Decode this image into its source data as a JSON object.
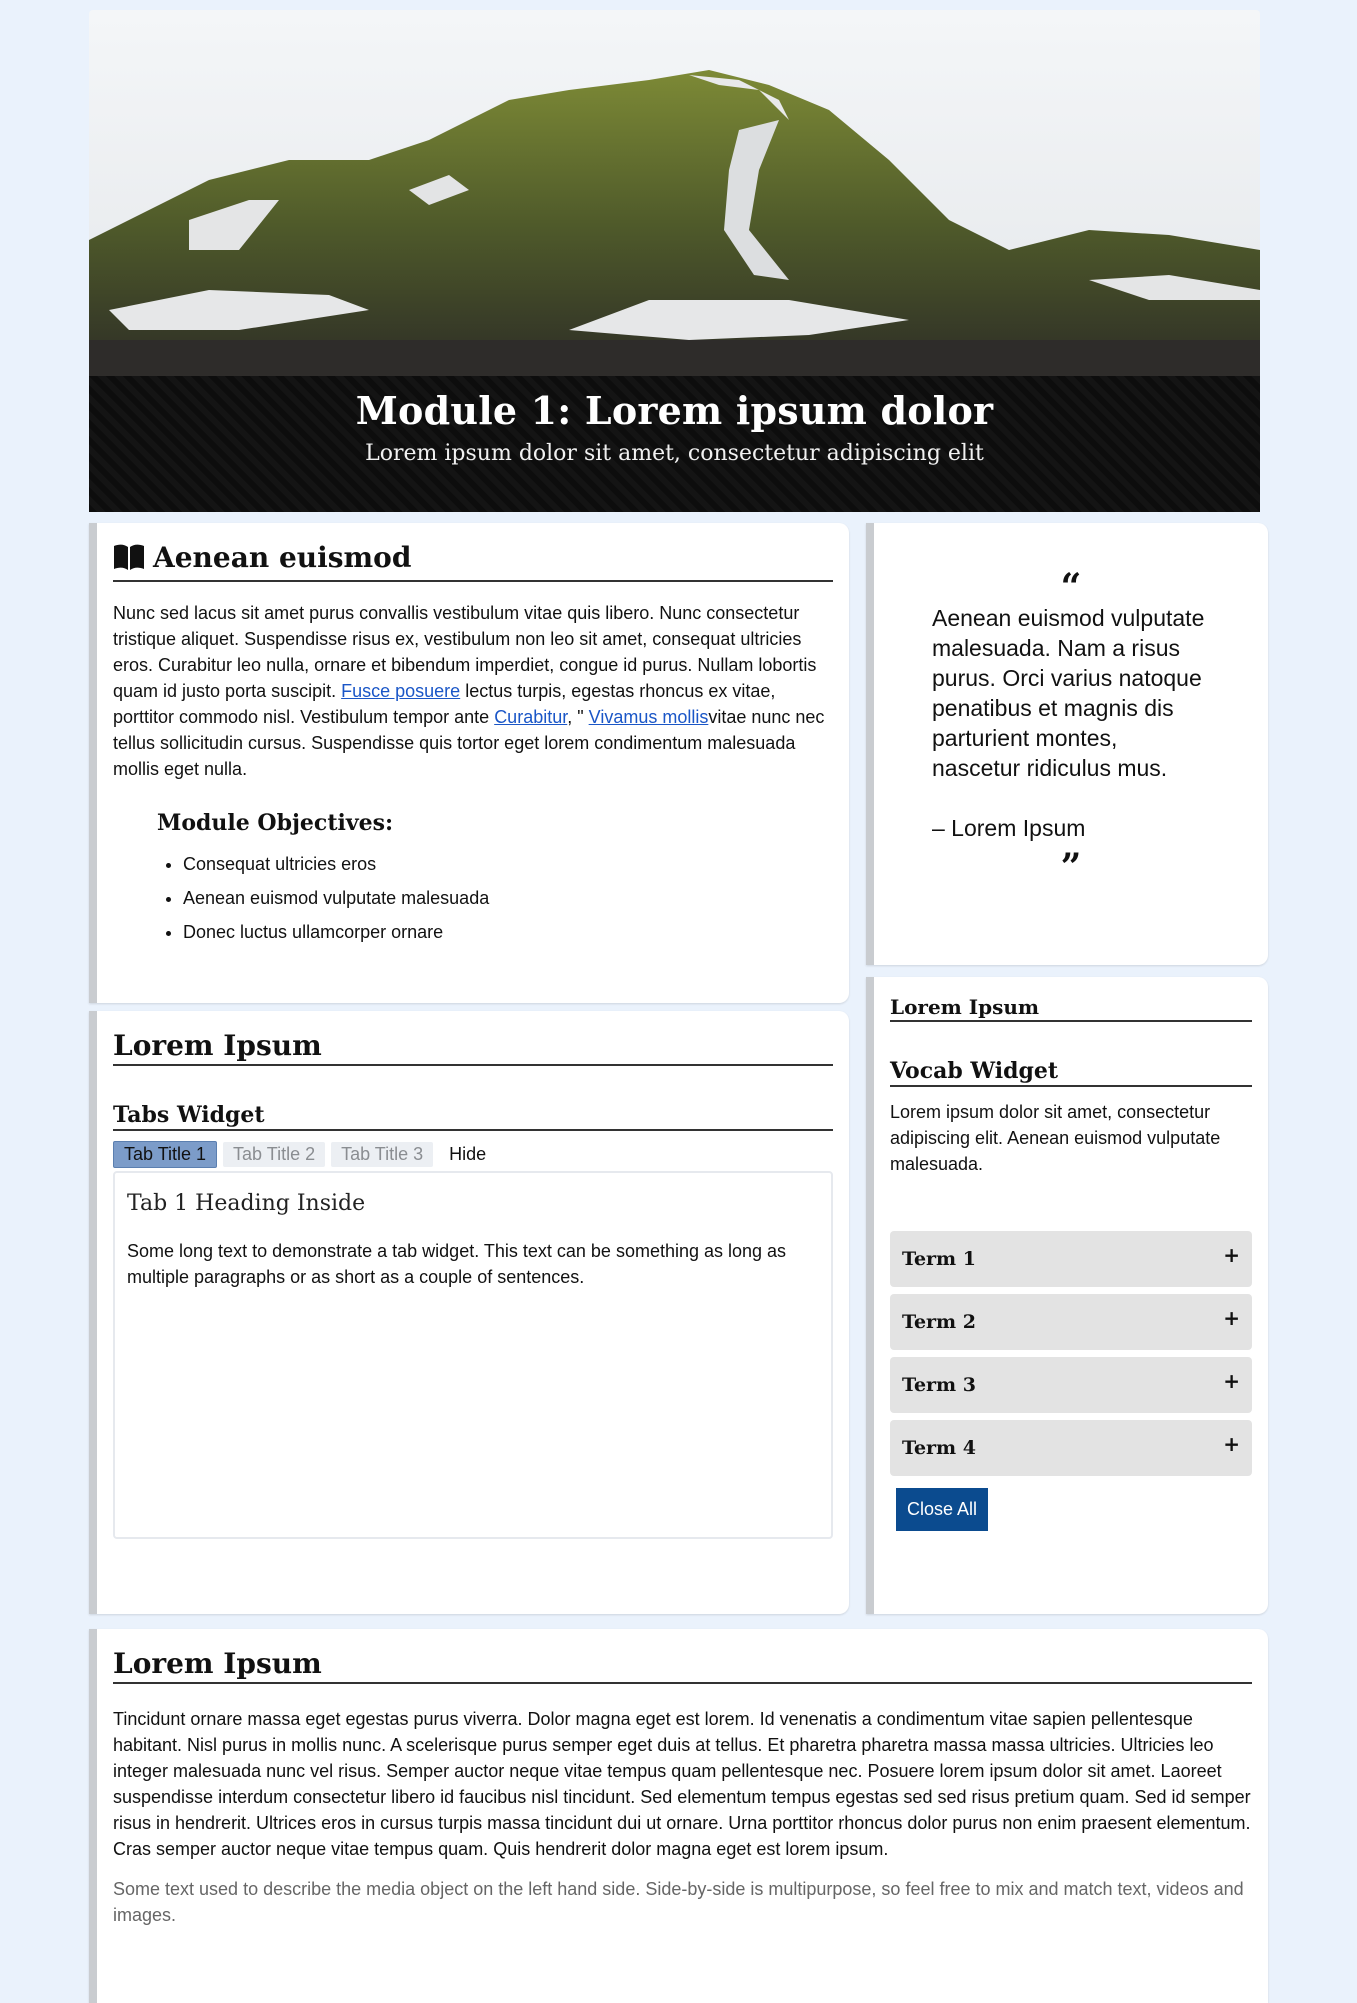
{
  "banner": {
    "title": "Module 1: Lorem ipsum dolor",
    "subtitle": "Lorem ipsum dolor sit amet, consectetur adipiscing elit",
    "image_icon": "mountain-landscape-image"
  },
  "intro": {
    "heading": "Aenean euismod",
    "heading_icon": "book-open-icon",
    "para_1": "Nunc sed lacus sit amet purus convallis vestibulum vitae quis libero. Nunc consectetur tristique aliquet. Suspendisse risus ex, vestibulum non leo sit amet, consequat ultricies eros. Curabitur leo nulla, ornare et bibendum imperdiet, congue id purus. Nullam lobortis quam id justo porta suscipit. ",
    "link_1": "Fusce posuere",
    "para_2": " lectus turpis, egestas rhoncus ex vitae, porttitor commodo nisl. Vestibulum tempor ante ",
    "link_2": "Curabitur",
    "para_3": ", \" ",
    "link_3": "Vivamus mollis",
    "para_4": "vitae nunc nec tellus sollicitudin cursus. Suspendisse quis tortor eget lorem condimentum malesuada mollis eget nulla.",
    "objectives_title": "Module Objectives:",
    "objectives": [
      "Consequat ultricies eros",
      "Aenean euismod vulputate malesuada",
      "Donec luctus ullamcorper ornare"
    ]
  },
  "tabs_card": {
    "heading": "Lorem Ipsum",
    "widget_title": "Tabs Widget",
    "tabs": [
      "Tab Title 1",
      "Tab Title 2",
      "Tab Title 3"
    ],
    "hide_label": "Hide",
    "panel_heading": "Tab 1 Heading Inside",
    "panel_text": "Some long text to demonstrate a tab widget. This text can be something as long as multiple paragraphs or as short as a couple of sentences."
  },
  "quote": {
    "open_mark": "“",
    "text": "Aenean euismod vulputate malesuada. Nam a risus purus. Orci varius natoque penatibus et magnis dis parturient montes, nascetur ridiculus mus.",
    "author": "– Lorem Ipsum",
    "close_mark": "”"
  },
  "vocab": {
    "heading": "Lorem Ipsum",
    "widget_title": "Vocab Widget",
    "description": "Lorem ipsum dolor sit amet, consectetur adipiscing elit. Aenean euismod vulputate malesuada.",
    "terms": [
      "Term 1",
      "Term 2",
      "Term 3",
      "Term 4"
    ],
    "expand_icon": "plus-icon",
    "close_all_label": "Close All"
  },
  "bottom": {
    "heading": "Lorem Ipsum",
    "paragraph": "Tincidunt ornare massa eget egestas purus viverra. Dolor magna eget est lorem. Id venenatis a condimentum vitae sapien pellentesque habitant. Nisl purus in mollis nunc. A scelerisque purus semper eget duis at tellus. Et pharetra pharetra massa massa ultricies. Ultricies leo integer malesuada nunc vel risus. Semper auctor neque vitae tempus quam pellentesque nec. Posuere lorem ipsum dolor sit amet. Laoreet suspendisse interdum consectetur libero id faucibus nisl tincidunt. Sed elementum tempus egestas sed sed risus pretium quam. Sed id semper risus in hendrerit. Ultrices eros in cursus turpis massa tincidunt dui ut ornare. Urna porttitor rhoncus dolor purus non enim praesent elementum. Cras semper auctor neque vitae tempus quam. Quis hendrerit dolor magna eget est lorem ipsum.",
    "caption": "Some text used to describe the media object on the left hand side. Side-by-side is multipurpose, so feel free to mix and match text, videos and images."
  },
  "colors": {
    "page_bg": "#eaf2fc",
    "card_border": "#c9ccd0",
    "link": "#1a56c7",
    "active_tab": "#7c9cc9",
    "button": "#0b4b8f",
    "term_bg": "#e3e3e3"
  }
}
